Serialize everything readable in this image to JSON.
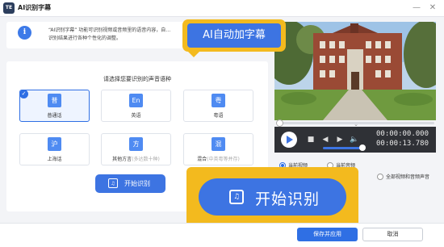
{
  "window": {
    "logo_text": "TE",
    "title": "AI识别字幕",
    "minimize_icon": "—",
    "close_icon": "✕"
  },
  "info": {
    "icon": "i",
    "line1": "“AI识别字幕” 功能可识别视频或音频里的语音内容，自…",
    "line2": "识别结果进行各种个性化的调整。"
  },
  "callout_top": {
    "label": "AI自动加字幕"
  },
  "language_panel": {
    "title": "请选择您要识别的声音语种",
    "options": [
      {
        "glyph": "普",
        "label": "普通话",
        "sub": "",
        "selected": true
      },
      {
        "glyph": "En",
        "label": "英语",
        "sub": "",
        "selected": false
      },
      {
        "glyph": "粤",
        "label": "粤语",
        "sub": "",
        "selected": false
      },
      {
        "glyph": "沪",
        "label": "上海话",
        "sub": "",
        "selected": false
      },
      {
        "glyph": "方",
        "label": "其他方言",
        "sub": "(多达数十种)",
        "selected": false
      },
      {
        "glyph": "混",
        "label": "混合",
        "sub": "(中英粤等并存)",
        "selected": false
      }
    ],
    "check_icon": "✓",
    "start_button": {
      "label": "开始识别",
      "icon": "♫"
    }
  },
  "player": {
    "play_icon": "play-icon",
    "stop_icon": "■",
    "prev_icon": "◀",
    "next_icon": "▶",
    "volume_icon": "🔈",
    "current_time": "00:00:00.000",
    "total_time": "00:00:13.780",
    "collapse_icon": "⌄",
    "volume_level": 1.0,
    "seek_position": 0.0
  },
  "scope": {
    "options": [
      {
        "label": "当前视频",
        "selected": true
      },
      {
        "label": "当前音频",
        "selected": false
      },
      {
        "label": "全部视频和音频声音",
        "selected": false
      }
    ]
  },
  "callout_big": {
    "label": "开始识别",
    "icon": "♫"
  },
  "footer": {
    "save_label": "保存并应用",
    "cancel_label": "取消"
  },
  "colors": {
    "accent": "#3d74e2",
    "highlight": "#f3ba1e"
  }
}
